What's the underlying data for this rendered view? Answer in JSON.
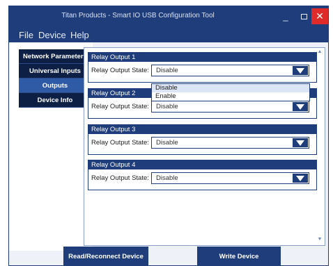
{
  "window": {
    "title": "Titan Products - Smart IO USB Configuration Tool",
    "controls": {
      "minimize": "_",
      "close": "✕"
    }
  },
  "menu": {
    "file": "File",
    "device": "Device",
    "help": "Help"
  },
  "sidebar": {
    "tabs": [
      {
        "label": "Network Parameters",
        "active": false
      },
      {
        "label": "Universal Inputs",
        "active": false
      },
      {
        "label": "Outputs",
        "active": true
      },
      {
        "label": "Device Info",
        "active": false
      }
    ]
  },
  "relays": [
    {
      "title": "Relay Output 1",
      "label": "Relay Output State:",
      "value": "Disable"
    },
    {
      "title": "Relay Output 2",
      "label": "Relay Output State:",
      "value": "Disable"
    },
    {
      "title": "Relay Output 3",
      "label": "Relay Output State:",
      "value": "Disable"
    },
    {
      "title": "Relay Output 4",
      "label": "Relay Output State:",
      "value": "Disable"
    }
  ],
  "dropdown": {
    "options": [
      "Disable",
      "Enable"
    ]
  },
  "buttons": {
    "read": "Read/Reconnect Device",
    "write": "Write Device"
  },
  "colors": {
    "navy": "#1f3d7a",
    "dark_tab": "#0d1f45",
    "active_tab": "#2f5aa6",
    "close": "#e02b2b"
  }
}
